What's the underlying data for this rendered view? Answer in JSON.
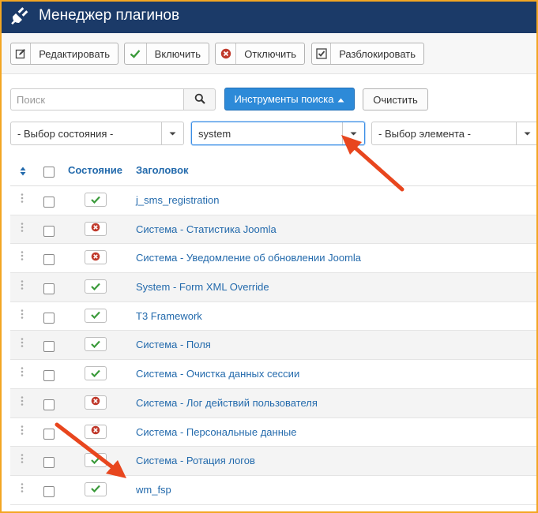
{
  "header": {
    "title": "Менеджер плагинов",
    "logo_icon": "plug-icon"
  },
  "toolbar": {
    "edit_label": "Редактировать",
    "enable_label": "Включить",
    "disable_label": "Отключить",
    "unblock_label": "Разблокировать"
  },
  "search": {
    "placeholder": "Поиск",
    "tools_label": "Инструменты поиска",
    "clear_label": "Очистить"
  },
  "filters": {
    "state": "- Выбор состояния -",
    "folder": "system",
    "element": "- Выбор элемента -"
  },
  "table": {
    "col_status": "Состояние",
    "col_title": "Заголовок",
    "rows": [
      {
        "title": "j_sms_registration",
        "enabled": true
      },
      {
        "title": "Система - Статистика Joomla",
        "enabled": false
      },
      {
        "title": "Система - Уведомление об обновлении Joomla",
        "enabled": false
      },
      {
        "title": "System - Form XML Override",
        "enabled": true
      },
      {
        "title": "T3 Framework",
        "enabled": true
      },
      {
        "title": "Система - Поля",
        "enabled": true
      },
      {
        "title": "Система - Очистка данных сессии",
        "enabled": true
      },
      {
        "title": "Система - Лог действий пользователя",
        "enabled": false
      },
      {
        "title": "Система - Персональные данные",
        "enabled": false
      },
      {
        "title": "Система - Ротация логов",
        "enabled": true
      },
      {
        "title": "wm_fsp",
        "enabled": true
      }
    ]
  },
  "colors": {
    "header_bg": "#1b3a68",
    "accent_blue": "#2d8ad8",
    "link": "#236aac",
    "enabled_green": "#3a9a3a",
    "disabled_red": "#c0392b",
    "annotation_arrow": "#e8461e",
    "frame_border": "#f3a623"
  }
}
